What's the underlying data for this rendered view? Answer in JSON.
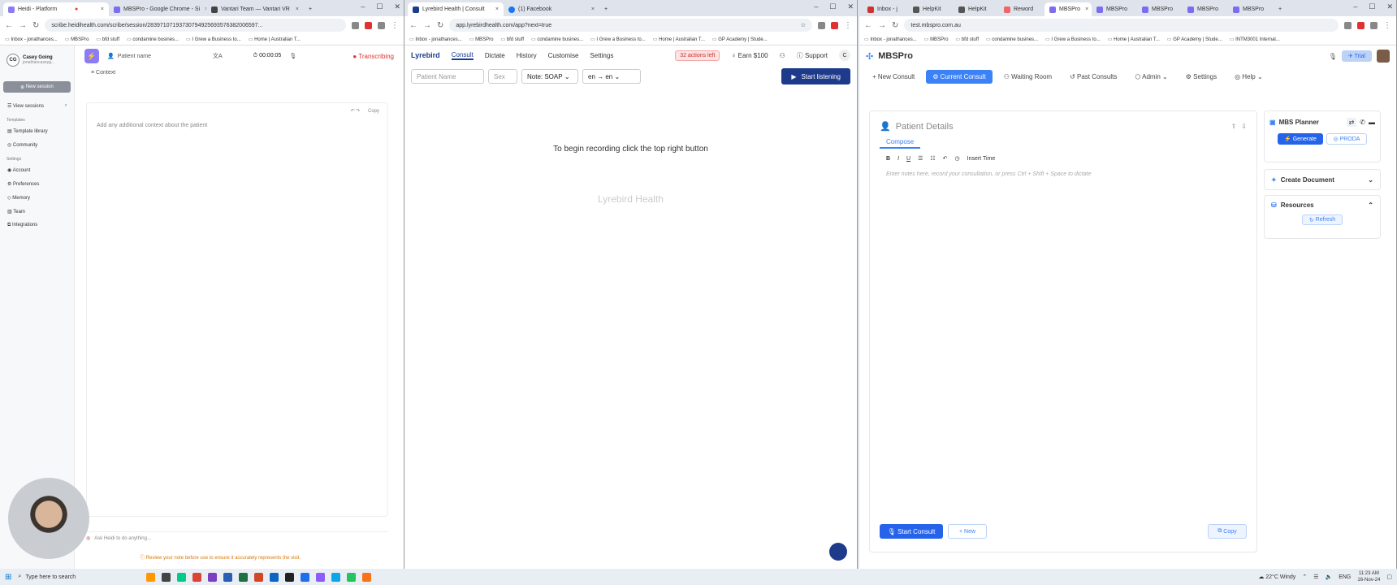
{
  "heidi": {
    "tabs": [
      {
        "label": "Heidi - Platform"
      },
      {
        "label": "MBSPro - Google Chrome - Si"
      },
      {
        "label": "Vantari Team — Vantari VR"
      }
    ],
    "url": "scribe.heidihealth.com/scribe/session/28397107193730794925693576382006597...",
    "bookmarks": [
      "Inbox - jonathances...",
      "MBSPro",
      "bfd stuff",
      "condamine busines...",
      "I Grew a Business to...",
      "Home | Australian T..."
    ],
    "user": {
      "initials": "CG",
      "name": "Casey Going",
      "email": "jonathancaseyg..."
    },
    "new_session": "New session",
    "view_sessions": "View sessions",
    "templates_header": "Templates",
    "template_library": "Template library",
    "community": "Community",
    "settings_header": "Settings",
    "account": "Account",
    "preferences": "Preferences",
    "memory": "Memory",
    "team": "Team",
    "integrations": "Integrations",
    "patient_name_placeholder": "Patient name",
    "timer": "00:00:05",
    "status": "Transcribing",
    "context_tab": "Context",
    "copy": "Copy",
    "context_placeholder": "Add any additional context about the patient",
    "ask_placeholder": "Ask Heidi to do anything...",
    "review_note": "Review your note before use to ensure it accurately represents the visit."
  },
  "lyrebird": {
    "tabs": [
      {
        "label": "Lyrebird Health | Consult"
      },
      {
        "label": "(1) Facebook"
      }
    ],
    "url": "app.lyrebirdhealth.com/app?next=true",
    "bookmarks": [
      "Inbox - jonathances...",
      "MBSPro",
      "bfd stuff",
      "condamine busines...",
      "I Grew a Business to...",
      "Home | Australian T...",
      "GP Academy | Stude..."
    ],
    "brand": "Lyrebird",
    "nav": [
      "Consult",
      "Dictate",
      "History",
      "Customise",
      "Settings"
    ],
    "actions_left": "32 actions left",
    "earn": "Earn $100",
    "support": "Support",
    "user_initial": "C",
    "patient_name_placeholder": "Patient Name",
    "sex_placeholder": "Sex",
    "note_select": "Note: SOAP",
    "lang_select": "en → en",
    "start_listening": "Start listening",
    "instruction": "To begin recording click the top right button",
    "watermark": "Lyrebird Health"
  },
  "mbspro": {
    "tabs": [
      {
        "label": "Inbox - j"
      },
      {
        "label": "HelpKit"
      },
      {
        "label": "HelpKit"
      },
      {
        "label": "Reword"
      },
      {
        "label": "MBSPro"
      },
      {
        "label": "MBSPro"
      },
      {
        "label": "MBSPro"
      },
      {
        "label": "MBSPro"
      },
      {
        "label": "MBSPro"
      }
    ],
    "url": "test.mbspro.com.au",
    "bookmarks": [
      "Inbox - jonathances...",
      "MBSPro",
      "bfd stuff",
      "condamine busines...",
      "I Grew a Business to...",
      "Home | Australian T...",
      "GP Academy | Stude...",
      "INTM3001 Internal..."
    ],
    "brand": "MBSPro",
    "trial": "Trial",
    "nav": [
      "New Consult",
      "Current Consult",
      "Waiting Room",
      "Past Consults",
      "Admin",
      "Settings",
      "Help"
    ],
    "patient_details": "Patient Details",
    "compose": "Compose",
    "insert_time": "Insert Time",
    "notes_placeholder": "Enter notes here, record your consultation, or press Ctrl + Shift + Space to dictate",
    "start_consult": "Start Consult",
    "new": "New",
    "copy": "Copy",
    "planner": "MBS Planner",
    "generate": "Generate",
    "proda": "PRODA",
    "create_document": "Create Document",
    "resources": "Resources",
    "refresh": "Refresh"
  },
  "taskbar": {
    "search_placeholder": "Type here to search",
    "weather": "22°C Windy",
    "lang": "ENG",
    "time": "11:23 AM",
    "date": "16-Nov-24"
  }
}
